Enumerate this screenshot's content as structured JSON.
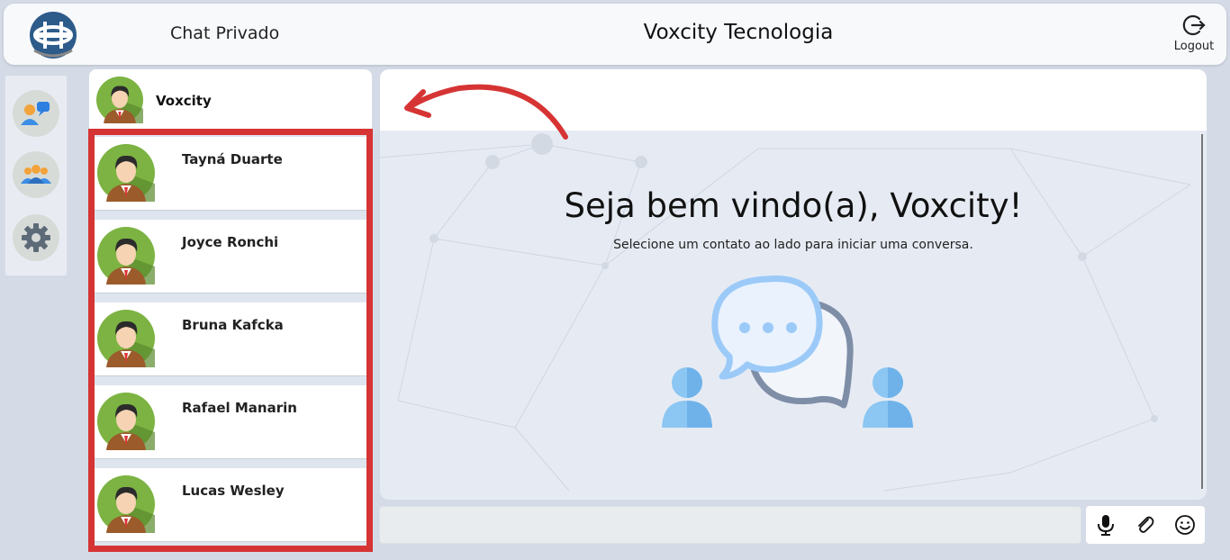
{
  "header": {
    "app_title": "Chat Privado",
    "company": "Voxcity Tecnologia",
    "logout_label": "Logout"
  },
  "rail": {
    "items": [
      {
        "icon": "contacts-chat-icon",
        "label": ""
      },
      {
        "icon": "group-icon",
        "label": ""
      },
      {
        "icon": "settings-gear-icon",
        "label": ""
      }
    ]
  },
  "me": {
    "name": "Voxcity",
    "avatar_icon": "user-avatar-icon"
  },
  "contacts": [
    {
      "name": "Tayná Duarte"
    },
    {
      "name": "Joyce Ronchi"
    },
    {
      "name": "Bruna Kafcka"
    },
    {
      "name": "Rafael Manarin"
    },
    {
      "name": "Lucas Wesley"
    }
  ],
  "welcome": {
    "title": "Seja bem vindo(a), Voxcity!",
    "subtitle": "Selecione um contato ao lado para iniciar uma conversa."
  },
  "composer": {
    "placeholder": "",
    "tools": [
      "microphone-icon",
      "paperclip-icon",
      "emoji-icon"
    ]
  },
  "colors": {
    "page_bg": "#d4dbe7",
    "highlight_border": "#d63434",
    "annotation_arrow": "#d63434",
    "logo_blue": "#2d5b8a"
  }
}
